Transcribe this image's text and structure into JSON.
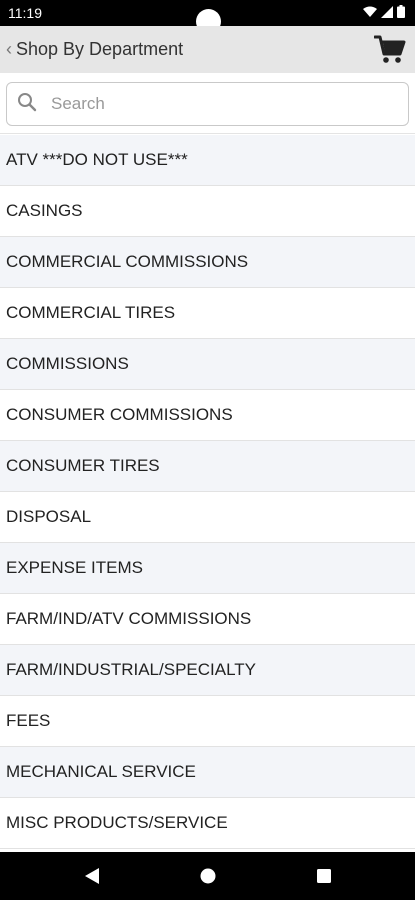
{
  "status_bar": {
    "time": "11:19"
  },
  "header": {
    "title": "Shop By Department"
  },
  "search": {
    "placeholder": "Search"
  },
  "departments": [
    "ATV ***DO NOT USE***",
    "CASINGS",
    "COMMERCIAL COMMISSIONS",
    "COMMERCIAL TIRES",
    "COMMISSIONS",
    "CONSUMER COMMISSIONS",
    "CONSUMER TIRES",
    "DISPOSAL",
    "EXPENSE ITEMS",
    "FARM/IND/ATV COMMISSIONS",
    "FARM/INDUSTRIAL/SPECIALTY",
    "FEES",
    "MECHANICAL SERVICE",
    "MISC PRODUCTS/SERVICE"
  ],
  "icons": {
    "back": "chevron-left-icon",
    "cart": "shopping-cart-icon",
    "search": "search-icon",
    "wifi": "wifi-icon",
    "signal": "signal-icon",
    "battery": "battery-icon",
    "nav_back": "back-triangle-icon",
    "nav_home": "home-circle-icon",
    "nav_recents": "recents-square-icon"
  },
  "colors": {
    "header_bg": "#e6e6e6",
    "row_alt_bg": "#f3f5f9",
    "system_bar_bg": "#000000"
  }
}
